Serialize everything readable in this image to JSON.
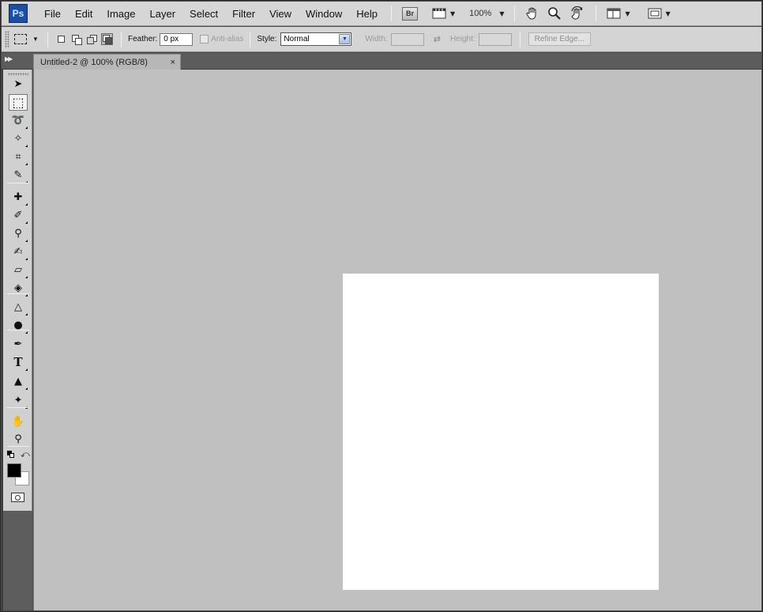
{
  "app": {
    "logo": "Ps",
    "menu": [
      "File",
      "Edit",
      "Image",
      "Layer",
      "Select",
      "Filter",
      "View",
      "Window",
      "Help"
    ],
    "bridge_label": "Br",
    "zoom": "100%"
  },
  "options": {
    "feather_label": "Feather:",
    "feather_value": "0 px",
    "antialias_label": "Anti-alias",
    "style_label": "Style:",
    "style_value": "Normal",
    "width_label": "Width:",
    "height_label": "Height:",
    "refine_edge_label": "Refine Edge..."
  },
  "document": {
    "tab_title": "Untitled-2 @ 100% (RGB/8)",
    "close_glyph": "×",
    "canvas_color": "#ffffff"
  },
  "colors": {
    "foreground": "#000000",
    "background": "#ffffff",
    "workspace": "#c0c0c0"
  },
  "tools": [
    {
      "name": "move-tool-icon",
      "glyph": "➤"
    },
    {
      "name": "rectangular-marquee-tool-icon",
      "glyph": "⬚",
      "selected": true
    },
    {
      "name": "lasso-tool-icon",
      "glyph": "➰"
    },
    {
      "name": "magic-wand-tool-icon",
      "glyph": "✧"
    },
    {
      "name": "crop-tool-icon",
      "glyph": "⌗"
    },
    {
      "name": "eyedropper-tool-icon",
      "glyph": "✎"
    },
    {
      "name": "healing-brush-tool-icon",
      "glyph": "✚"
    },
    {
      "name": "brush-tool-icon",
      "glyph": "✐"
    },
    {
      "name": "clone-stamp-tool-icon",
      "glyph": "⚲"
    },
    {
      "name": "history-brush-tool-icon",
      "glyph": "✍"
    },
    {
      "name": "eraser-tool-icon",
      "glyph": "▱"
    },
    {
      "name": "paint-bucket-tool-icon",
      "glyph": "◈"
    },
    {
      "name": "blur-tool-icon",
      "glyph": "△"
    },
    {
      "name": "dodge-tool-icon",
      "glyph": "●"
    },
    {
      "name": "pen-tool-icon",
      "glyph": "✒"
    },
    {
      "name": "type-tool-icon",
      "glyph": "T"
    },
    {
      "name": "path-selection-tool-icon",
      "glyph": "▲"
    },
    {
      "name": "custom-shape-tool-icon",
      "glyph": "✦"
    },
    {
      "name": "hand-tool-icon",
      "glyph": "✋"
    },
    {
      "name": "zoom-tool-icon",
      "glyph": "⚲"
    }
  ]
}
